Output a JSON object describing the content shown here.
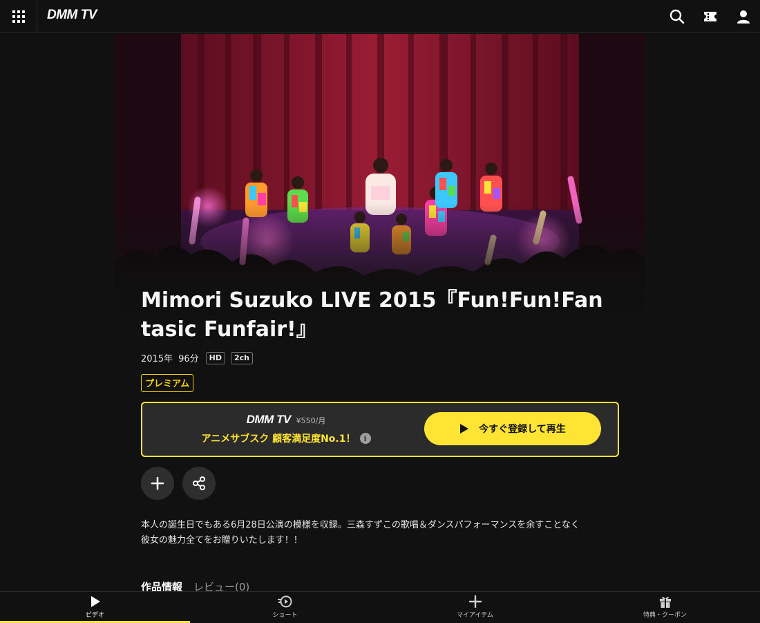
{
  "header": {
    "logo": "DMM TV",
    "icons": [
      "grid-menu-icon",
      "search-icon",
      "ticket-icon",
      "user-icon"
    ]
  },
  "hero": {
    "image": "live-concert-stage-photo"
  },
  "title": {
    "line1": "Mimori Suzuko LIVE 2015『Fun!Fun!Fan",
    "line2": "tasic Funfair!』"
  },
  "meta": {
    "year": "2015年",
    "duration": "96分",
    "quality": "HD",
    "audio": "2ch"
  },
  "premium_badge": "プレミアム",
  "subscription": {
    "logo": "DMM TV",
    "price": "¥550/月",
    "catchphrase": "アニメサブスク 顧客満足度No.1！",
    "info_icon": "i",
    "cta_label": "今すぐ登録して再生"
  },
  "actions": {
    "add": "plus-icon",
    "share": "share-icon"
  },
  "description": {
    "line1": "本人の誕生日でもある6月28日公演の模様を収録。三森すずこの歌唱＆ダンスパフォーマンスを余すことなく",
    "line2": "彼女の魅力全てをお贈りいたします！！"
  },
  "tabs": [
    {
      "label": "作品情報",
      "active": true
    },
    {
      "label": "レビュー(0)",
      "active": false
    }
  ],
  "bottom_nav": [
    {
      "label": "ビデオ",
      "icon": "play-icon",
      "active": true
    },
    {
      "label": "ショート",
      "icon": "short-icon",
      "active": false
    },
    {
      "label": "マイアイテム",
      "icon": "plus-icon",
      "active": false
    },
    {
      "label": "特典・クーポン",
      "icon": "gift-icon",
      "active": false
    }
  ],
  "colors": {
    "accent": "#ffe433",
    "background": "#111111",
    "premium": "#f5d000"
  }
}
